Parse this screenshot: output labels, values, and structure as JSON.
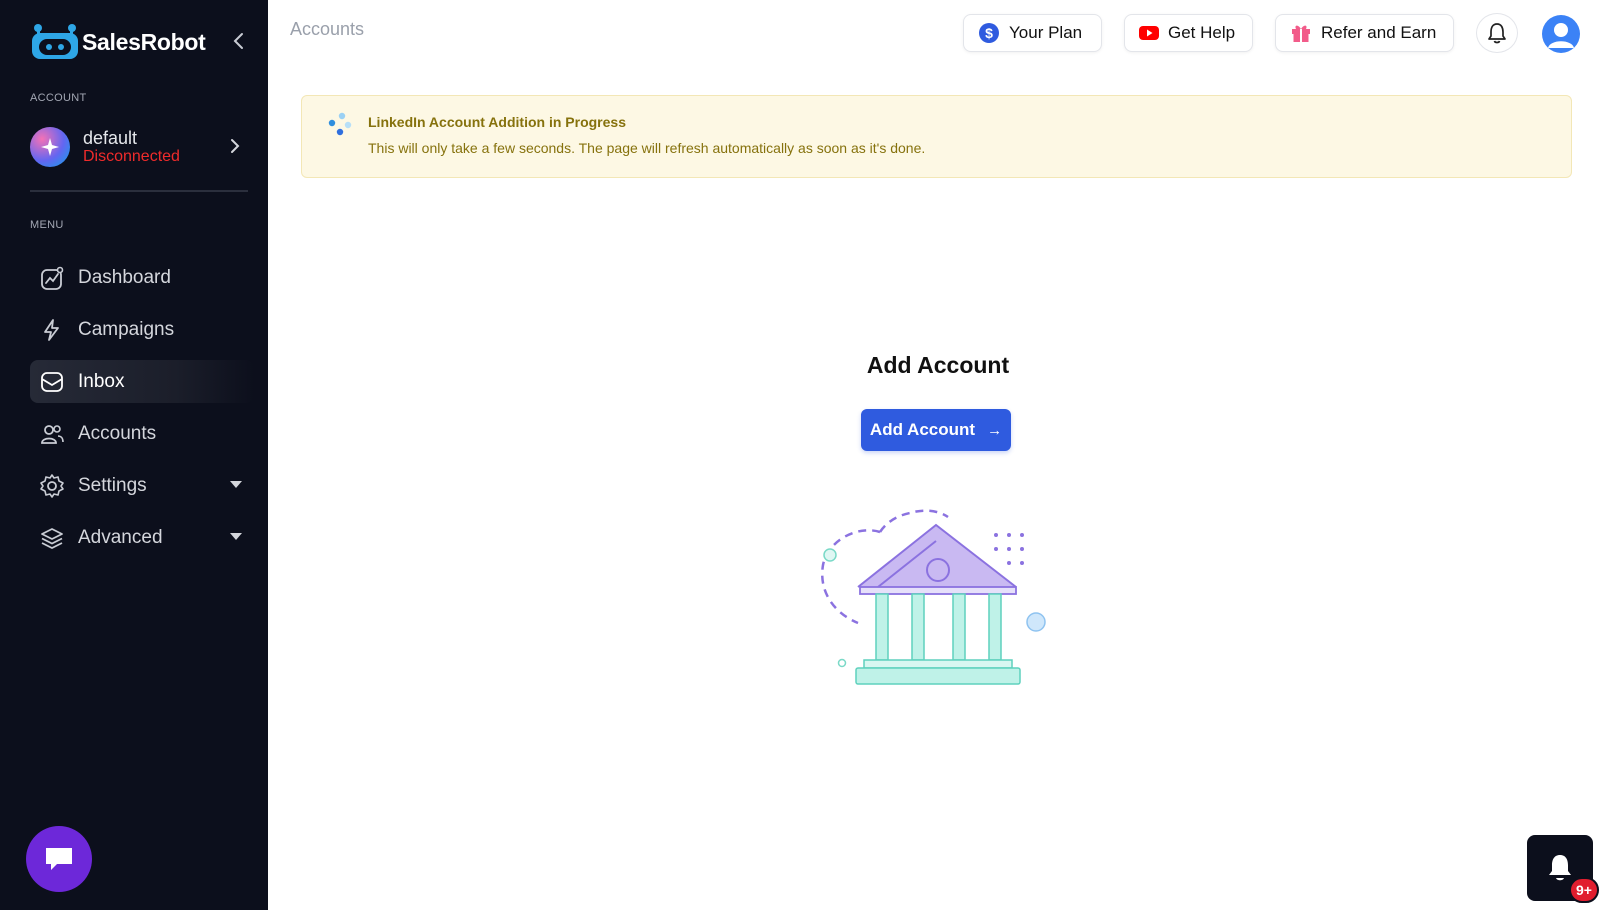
{
  "app": {
    "name": "SalesRobot"
  },
  "sidebar": {
    "account_section_label": "ACCOUNT",
    "account": {
      "name": "default",
      "status": "Disconnected"
    },
    "menu_section_label": "MENU",
    "items": [
      {
        "label": "Dashboard",
        "icon": "chart-icon"
      },
      {
        "label": "Campaigns",
        "icon": "bolt-icon"
      },
      {
        "label": "Inbox",
        "icon": "mail-icon",
        "active": true
      },
      {
        "label": "Accounts",
        "icon": "users-icon"
      },
      {
        "label": "Settings",
        "icon": "gear-icon",
        "has_dropdown": true
      },
      {
        "label": "Advanced",
        "icon": "layers-icon",
        "has_dropdown": true
      }
    ]
  },
  "header": {
    "breadcrumb": "Accounts",
    "your_plan_label": "Your Plan",
    "get_help_label": "Get Help",
    "refer_label": "Refer and Earn"
  },
  "banner": {
    "title": "LinkedIn Account Addition in Progress",
    "message": "This will only take a few seconds. The page will refresh automatically as soon as it's done."
  },
  "main": {
    "title": "Add Account",
    "button_label": "Add Account"
  },
  "notifications": {
    "badge": "9+"
  },
  "colors": {
    "sidebar_bg": "#0c0f1c",
    "primary": "#2f5bdf",
    "status_error": "#ef2b2b",
    "banner_bg": "#fdf8e4",
    "banner_text": "#86720d",
    "chat_purple": "#6d28d9"
  }
}
